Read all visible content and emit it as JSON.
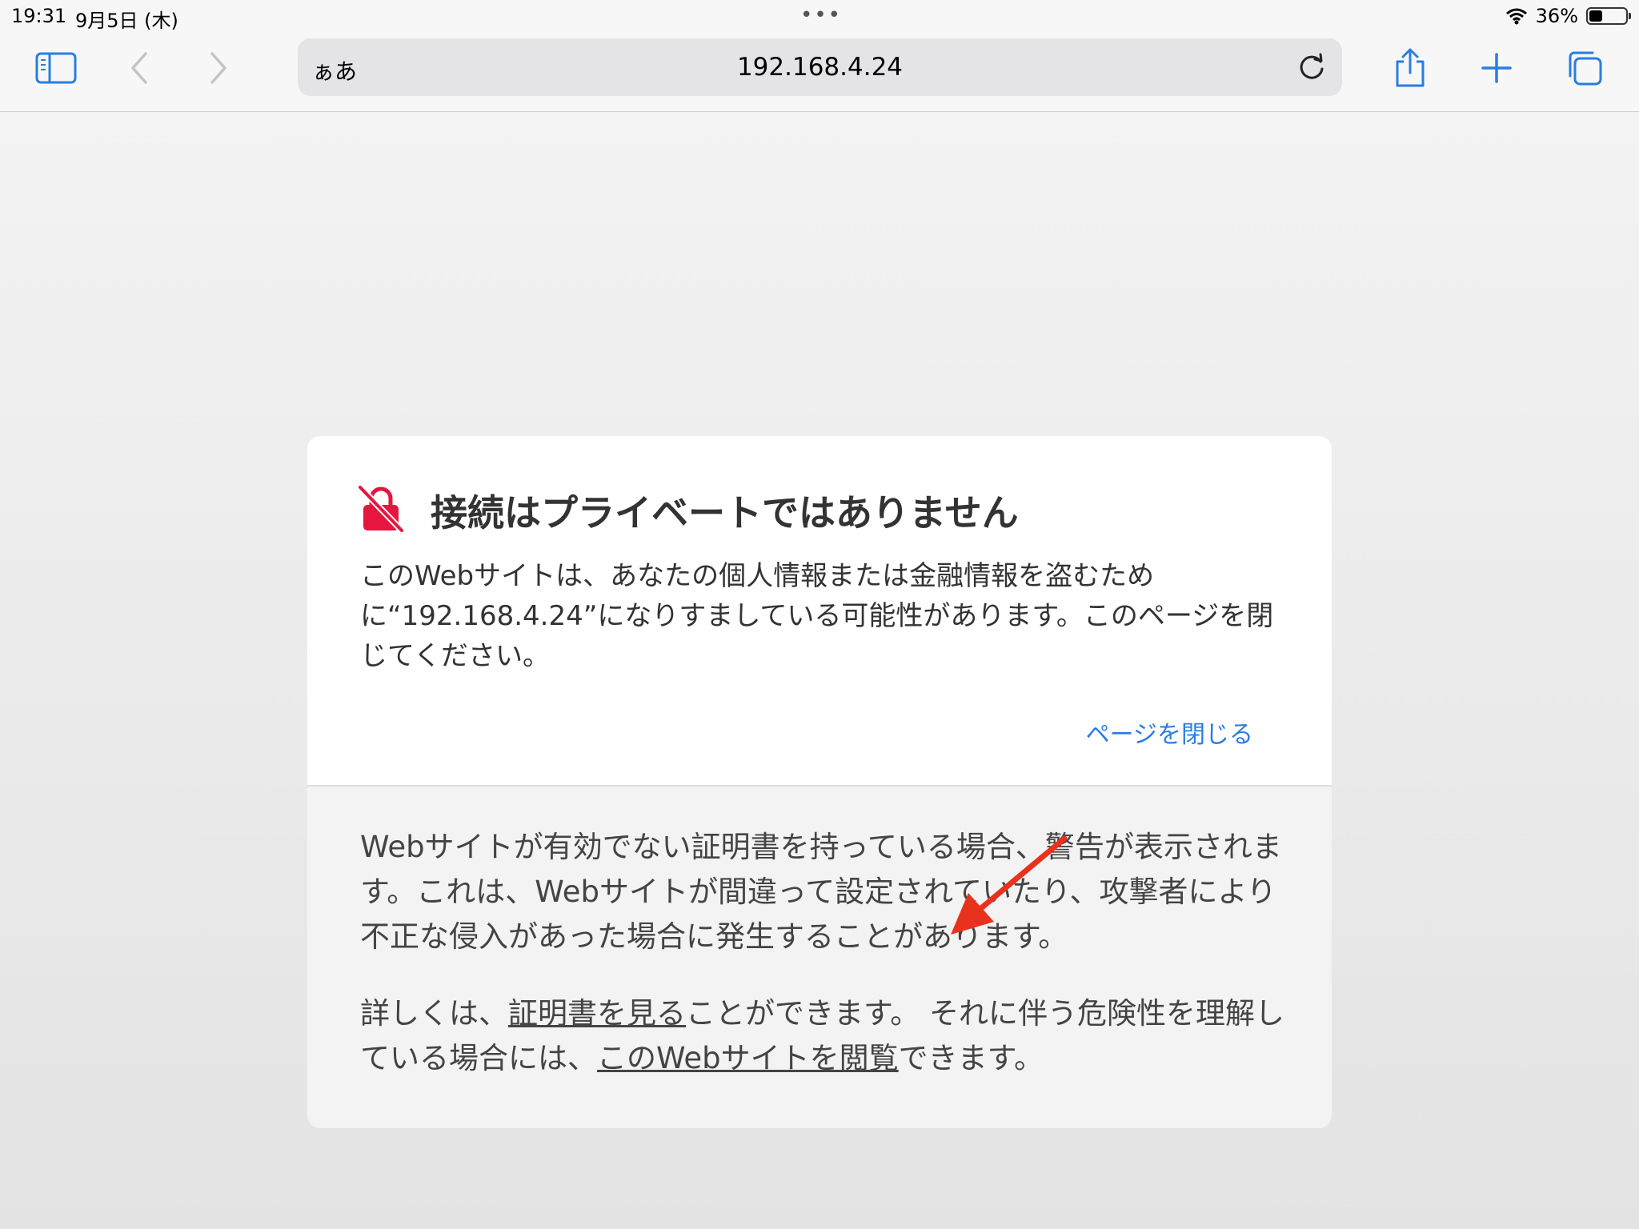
{
  "status_bar": {
    "time": "19:31",
    "date": "9月5日 (木)",
    "dots": "•••",
    "battery_percent": "36%",
    "battery_level": 0.36
  },
  "toolbar": {
    "reader_label": "ぁあ",
    "url": "192.168.4.24",
    "icons": [
      "sidebar-icon",
      "back-icon",
      "forward-icon",
      "reload-icon",
      "share-icon",
      "add-tab-icon",
      "tabs-icon"
    ]
  },
  "warning": {
    "title": "接続はプライベートではありません",
    "message": "このWebサイトは、あなたの個人情報または金融情報を盗むために“192.168.4.24”になりすましている可能性があります。このページを閉じてください。",
    "close_link": "ページを閉じる",
    "explanation": "Webサイトが有効でない証明書を持っている場合、警告が表示されます。これは、Webサイトが間違って設定されていたり、攻撃者により不正な侵入があった場合に発生することがあります。",
    "details_prefix": "詳しくは、",
    "view_certificate_link": "証明書を見る",
    "details_middle": "ことができます。 それに伴う危険性を理解している場合には、",
    "visit_site_link": "このWebサイトを閲覧",
    "details_suffix": "できます。"
  },
  "colors": {
    "accent": "#2a7de1",
    "warning_icon": "#e5163f",
    "annotation_arrow": "#e8321e"
  }
}
